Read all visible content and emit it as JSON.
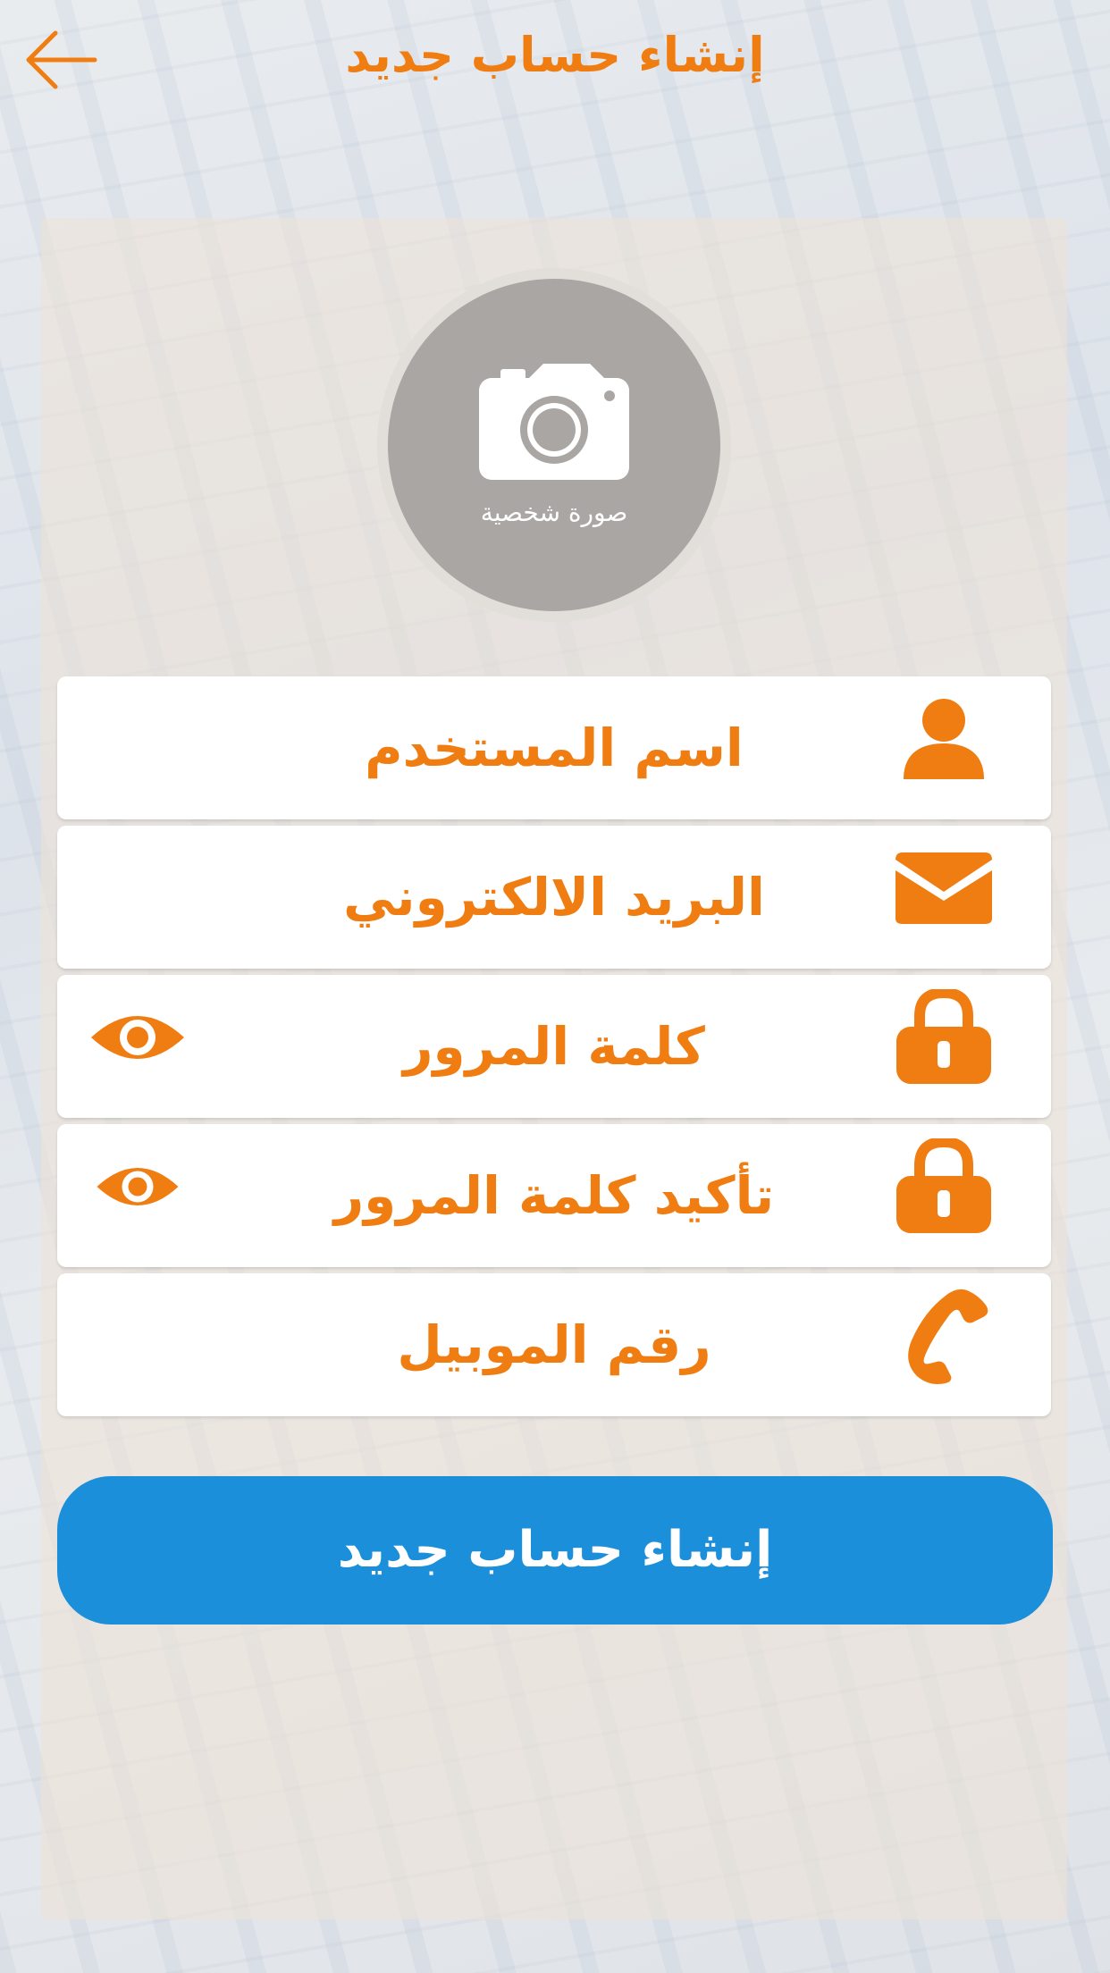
{
  "header": {
    "title": "إنشاء حساب جديد",
    "back_icon": "arrow-left-icon"
  },
  "avatar": {
    "caption": "صورة شخصية",
    "icon": "camera-icon"
  },
  "form": {
    "fields": [
      {
        "label": "اسم المستخدم",
        "icon": "user-icon"
      },
      {
        "label": "البريد الالكتروني",
        "icon": "envelope-icon"
      },
      {
        "label": "كلمة المرور",
        "icon": "lock-icon",
        "toggle_icon": "eye-icon"
      },
      {
        "label": "تأكيد كلمة المرور",
        "icon": "lock-icon",
        "toggle_icon": "eye-icon"
      },
      {
        "label": "رقم الموبيل",
        "icon": "phone-icon"
      }
    ],
    "submit_label": "إنشاء حساب جديد"
  },
  "colors": {
    "accent": "#f07d12",
    "button": "#1b8fd9",
    "field_bg": "#ffffff"
  }
}
